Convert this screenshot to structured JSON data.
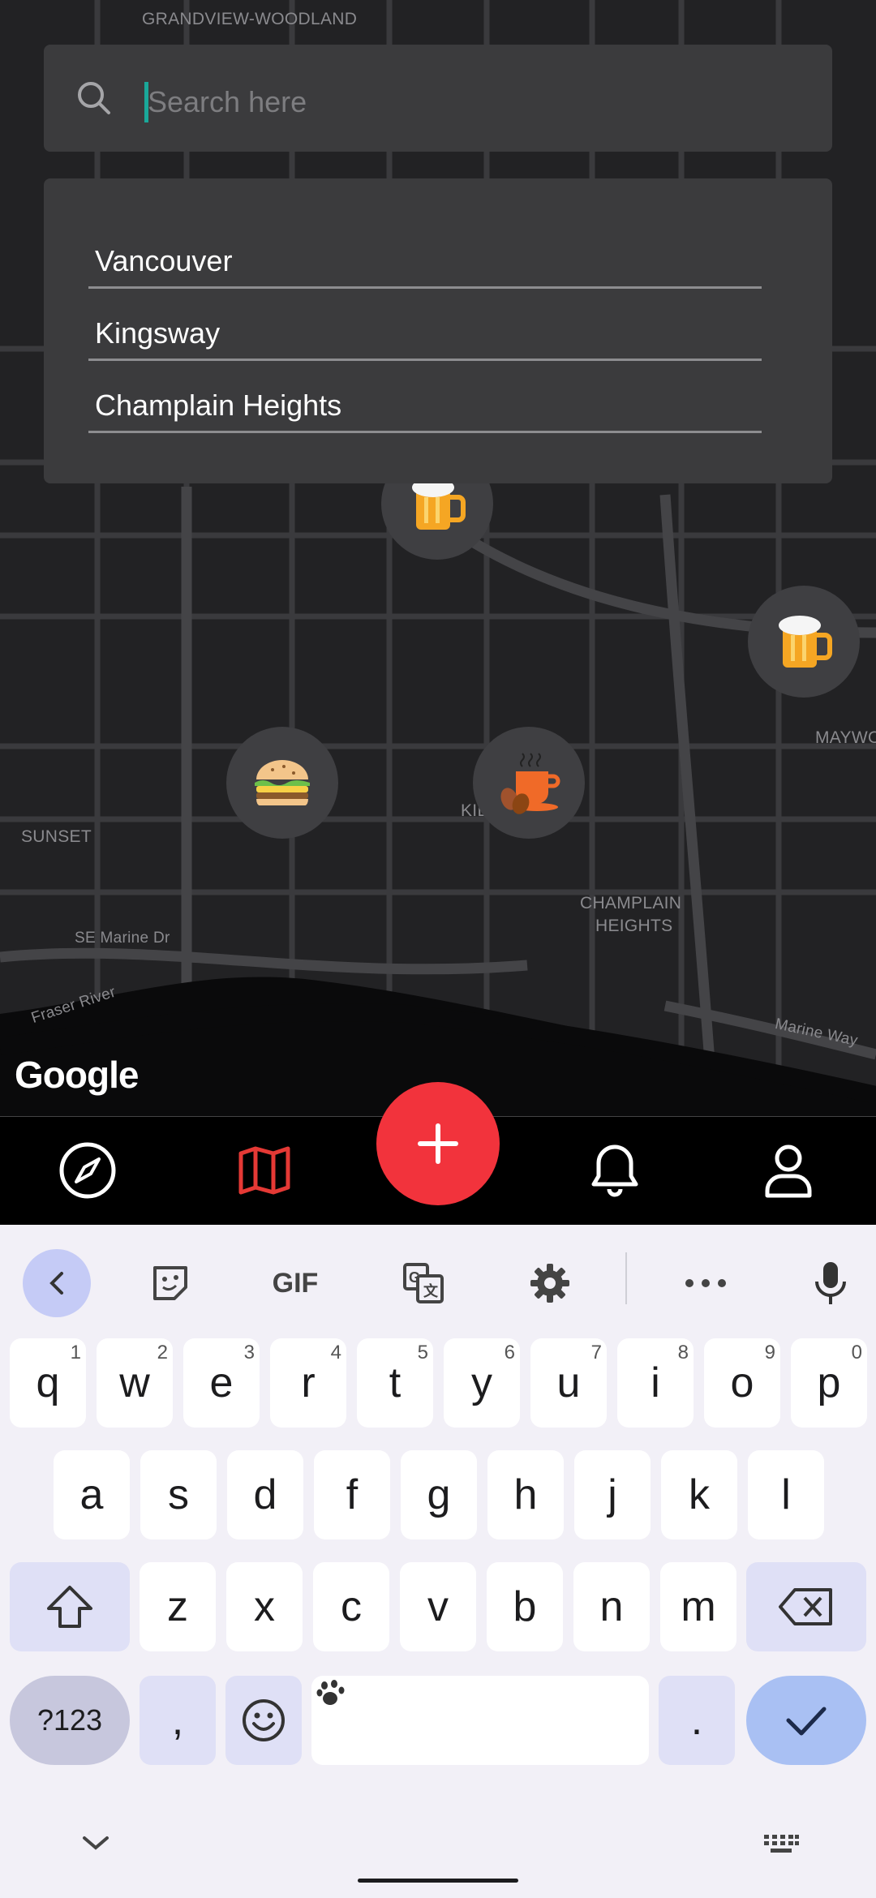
{
  "map": {
    "labels": {
      "grandview": "GRANDVIEW-WOODLAND",
      "sunset": "SUNSET",
      "se_marine": "SE Marine Dr",
      "fraser": "Fraser River",
      "kil": "KIL",
      "champlain": "CHAMPLAIN",
      "heights": "HEIGHTS",
      "maywood": "MAYWO",
      "marine_way": "Marine Way"
    },
    "attribution": "Google",
    "markers": [
      "beer-marker",
      "beer-marker",
      "burger-marker",
      "coffee-marker"
    ]
  },
  "search": {
    "placeholder": "Search here",
    "value": ""
  },
  "suggestions": [
    "Vancouver",
    "Kingsway",
    "Champlain Heights"
  ],
  "bottom_nav": {
    "items": [
      "explore-icon",
      "map-icon",
      "add-icon",
      "bell-icon",
      "profile-icon"
    ],
    "active": "map-icon",
    "accent": "#f2333c"
  },
  "keyboard": {
    "toolbar": {
      "gif": "GIF"
    },
    "row1": [
      {
        "k": "q",
        "h": "1"
      },
      {
        "k": "w",
        "h": "2"
      },
      {
        "k": "e",
        "h": "3"
      },
      {
        "k": "r",
        "h": "4"
      },
      {
        "k": "t",
        "h": "5"
      },
      {
        "k": "y",
        "h": "6"
      },
      {
        "k": "u",
        "h": "7"
      },
      {
        "k": "i",
        "h": "8"
      },
      {
        "k": "o",
        "h": "9"
      },
      {
        "k": "p",
        "h": "0"
      }
    ],
    "row2": [
      "a",
      "s",
      "d",
      "f",
      "g",
      "h",
      "j",
      "k",
      "l"
    ],
    "row3": [
      "z",
      "x",
      "c",
      "v",
      "b",
      "n",
      "m"
    ],
    "symbols": "?123",
    "comma": ",",
    "period": "."
  }
}
